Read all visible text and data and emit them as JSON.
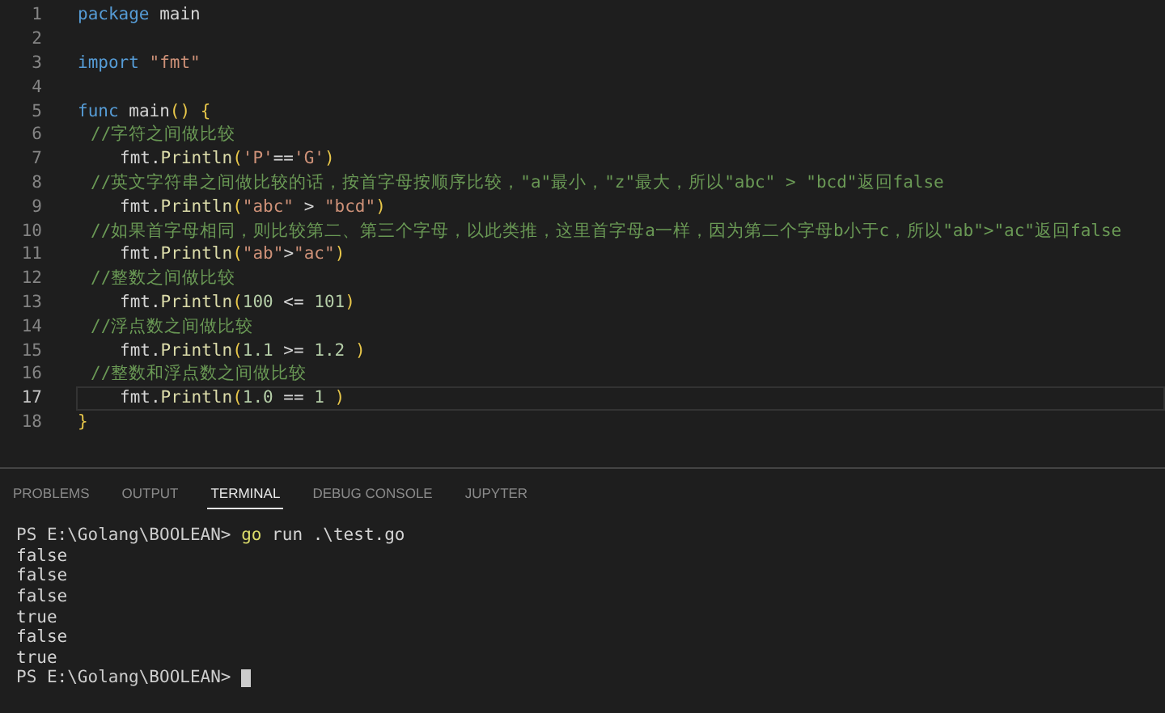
{
  "editor": {
    "lines": [
      {
        "number": "1",
        "selected": false,
        "tokens": [
          {
            "kind": "keyword",
            "text": "package"
          },
          {
            "kind": "plain",
            "text": " main"
          }
        ]
      },
      {
        "number": "2",
        "selected": false
      },
      {
        "number": "3",
        "selected": false,
        "tokens": [
          {
            "kind": "keyword",
            "text": "import"
          },
          {
            "kind": "string",
            "text": " \"fmt\""
          }
        ]
      },
      {
        "number": "4",
        "selected": false
      },
      {
        "number": "5",
        "selected": false,
        "tokens": [
          {
            "kind": "keyword",
            "text": "func"
          },
          {
            "kind": "plain",
            "text": " main"
          },
          {
            "kind": "bracket",
            "text": "() {"
          }
        ],
        "children": [
          {
            "number": "6",
            "selected": false,
            "tokens": [
              {
                "kind": "comment",
                "text": "//字符之间做比较"
              }
            ],
            "children": [
              {
                "number": "7",
                "selected": false,
                "tokens": [
                  {
                    "kind": "plain",
                    "text": "fmt."
                  },
                  {
                    "kind": "function",
                    "text": "Println"
                  },
                  {
                    "kind": "bracket",
                    "text": "("
                  },
                  {
                    "kind": "string",
                    "text": "'P'"
                  },
                  {
                    "kind": "plain",
                    "text": "=="
                  },
                  {
                    "kind": "string",
                    "text": "'G'"
                  },
                  {
                    "kind": "bracket",
                    "text": ")"
                  }
                ]
              }
            ]
          },
          {
            "number": "8",
            "selected": false,
            "tokens": [
              {
                "kind": "comment",
                "text": "//英文字符串之间做比较的话，按首字母按顺序比较，\"a\"最小，\"z\"最大，所以\"abc\" > \"bcd\"返回false"
              }
            ],
            "children": [
              {
                "number": "9",
                "selected": false,
                "tokens": [
                  {
                    "kind": "plain",
                    "text": "fmt."
                  },
                  {
                    "kind": "function",
                    "text": "Println"
                  },
                  {
                    "kind": "bracket",
                    "text": "("
                  },
                  {
                    "kind": "string",
                    "text": "\"abc\""
                  },
                  {
                    "kind": "plain",
                    "text": " > "
                  },
                  {
                    "kind": "string",
                    "text": "\"bcd\""
                  },
                  {
                    "kind": "bracket",
                    "text": ")"
                  }
                ]
              }
            ]
          },
          {
            "number": "10",
            "selected": false,
            "tokens": [
              {
                "kind": "comment",
                "text": "//如果首字母相同，则比较第二、第三个字母，以此类推，这里首字母a一样，因为第二个字母b小于c，所以\"ab\">\"ac\"返回false"
              }
            ],
            "children": [
              {
                "number": "11",
                "selected": false,
                "tokens": [
                  {
                    "kind": "plain",
                    "text": "fmt."
                  },
                  {
                    "kind": "function",
                    "text": "Println"
                  },
                  {
                    "kind": "bracket",
                    "text": "("
                  },
                  {
                    "kind": "string",
                    "text": "\"ab\""
                  },
                  {
                    "kind": "plain",
                    "text": ">"
                  },
                  {
                    "kind": "string",
                    "text": "\"ac\""
                  },
                  {
                    "kind": "bracket",
                    "text": ")"
                  }
                ]
              }
            ]
          },
          {
            "number": "12",
            "selected": false,
            "tokens": [
              {
                "kind": "comment",
                "text": "//整数之间做比较"
              }
            ],
            "children": [
              {
                "number": "13",
                "selected": false,
                "tokens": [
                  {
                    "kind": "plain",
                    "text": "fmt."
                  },
                  {
                    "kind": "function",
                    "text": "Println"
                  },
                  {
                    "kind": "bracket",
                    "text": "("
                  },
                  {
                    "kind": "number",
                    "text": "100"
                  },
                  {
                    "kind": "plain",
                    "text": " <= "
                  },
                  {
                    "kind": "number",
                    "text": "101"
                  },
                  {
                    "kind": "bracket",
                    "text": ")"
                  }
                ]
              }
            ]
          },
          {
            "number": "14",
            "selected": false,
            "tokens": [
              {
                "kind": "comment",
                "text": "//浮点数之间做比较"
              }
            ],
            "children": [
              {
                "number": "15",
                "selected": false,
                "tokens": [
                  {
                    "kind": "plain",
                    "text": "fmt."
                  },
                  {
                    "kind": "function",
                    "text": "Println"
                  },
                  {
                    "kind": "bracket",
                    "text": "("
                  },
                  {
                    "kind": "number",
                    "text": "1.1"
                  },
                  {
                    "kind": "plain",
                    "text": " >= "
                  },
                  {
                    "kind": "number",
                    "text": "1.2"
                  },
                  {
                    "kind": "bracket",
                    "text": " )"
                  }
                ]
              }
            ]
          },
          {
            "number": "16",
            "selected": false,
            "tokens": [
              {
                "kind": "comment",
                "text": "//整数和浮点数之间做比较"
              }
            ],
            "children": [
              {
                "number": "17",
                "selected": true,
                "tokens": [
                  {
                    "kind": "plain",
                    "text": "fmt."
                  },
                  {
                    "kind": "function",
                    "text": "Println"
                  },
                  {
                    "kind": "bracket",
                    "text": "("
                  },
                  {
                    "kind": "number",
                    "text": "1.0"
                  },
                  {
                    "kind": "plain",
                    "text": " == "
                  },
                  {
                    "kind": "number",
                    "text": "1"
                  },
                  {
                    "kind": "bracket",
                    "text": " )"
                  }
                ]
              }
            ]
          }
        ]
      },
      {
        "number": "18",
        "selected": false,
        "tokens": [
          {
            "kind": "bracket",
            "text": "}"
          }
        ]
      }
    ]
  },
  "panel": {
    "tabs": [
      {
        "label": "PROBLEMS",
        "selected": false
      },
      {
        "label": "OUTPUT",
        "selected": false
      },
      {
        "label": "TERMINAL",
        "selected": true
      },
      {
        "label": "DEBUG CONSOLE",
        "selected": false
      },
      {
        "label": "JUPYTER",
        "selected": false
      }
    ],
    "terminal": [
      {
        "cursor": false,
        "tokens": [
          {
            "kind": "prompt",
            "text": "PS E:\\Golang\\BOOLEAN> "
          },
          {
            "kind": "command",
            "text": "go"
          },
          {
            "kind": "plain",
            "text": " run .\\test.go"
          }
        ]
      },
      {
        "cursor": false,
        "tokens": [
          {
            "kind": "plain",
            "text": "false"
          }
        ]
      },
      {
        "cursor": false,
        "tokens": [
          {
            "kind": "plain",
            "text": "false"
          }
        ]
      },
      {
        "cursor": false,
        "tokens": [
          {
            "kind": "plain",
            "text": "false"
          }
        ]
      },
      {
        "cursor": false,
        "tokens": [
          {
            "kind": "plain",
            "text": "true"
          }
        ]
      },
      {
        "cursor": false,
        "tokens": [
          {
            "kind": "plain",
            "text": "false"
          }
        ]
      },
      {
        "cursor": false,
        "tokens": [
          {
            "kind": "plain",
            "text": "true"
          }
        ]
      },
      {
        "cursor": true,
        "tokens": [
          {
            "kind": "prompt",
            "text": "PS E:\\Golang\\BOOLEAN> "
          }
        ]
      }
    ]
  }
}
